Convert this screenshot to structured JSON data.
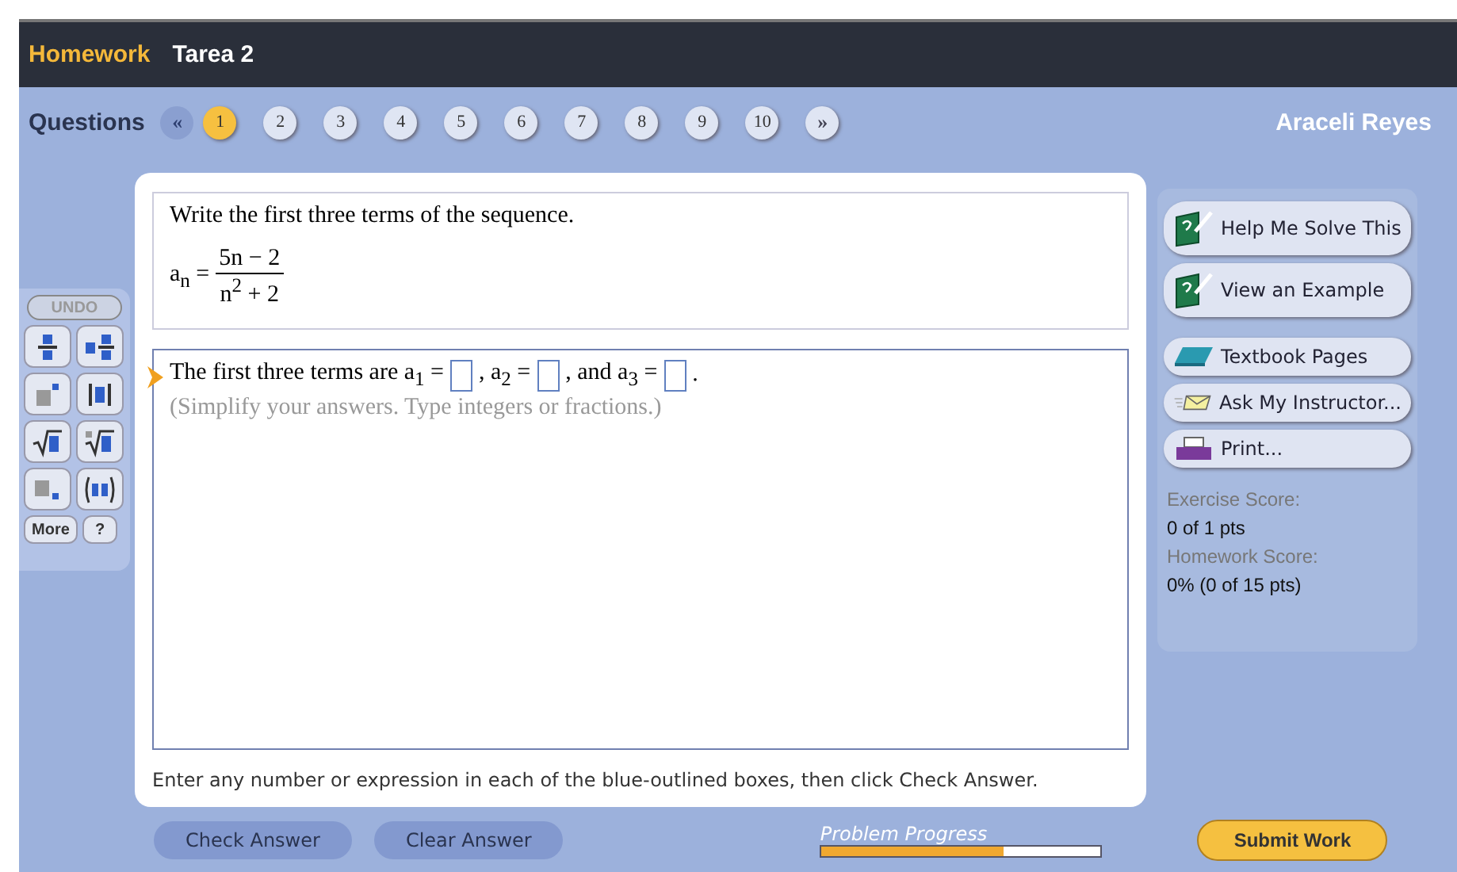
{
  "header": {
    "section": "Homework",
    "title": "Tarea 2"
  },
  "questions": {
    "label": "Questions",
    "prev": "«",
    "next": "»",
    "student": "Araceli Reyes",
    "items": [
      {
        "label": "1",
        "selected": true
      },
      {
        "label": "2",
        "selected": false
      },
      {
        "label": "3",
        "selected": false
      },
      {
        "label": "4",
        "selected": false
      },
      {
        "label": "5",
        "selected": false
      },
      {
        "label": "6",
        "selected": false
      },
      {
        "label": "7",
        "selected": false
      },
      {
        "label": "8",
        "selected": false
      },
      {
        "label": "9",
        "selected": false
      },
      {
        "label": "10",
        "selected": false
      }
    ]
  },
  "toolbar": {
    "undo": {
      "label": "UNDO",
      "disabled": true
    },
    "more": "More",
    "help": "?"
  },
  "question": {
    "prompt": "Write the first three terms of the sequence.",
    "lhs": "a$_{n}$ =",
    "numerator": "5n − 2",
    "denominator": "n$^{2}$ + 2"
  },
  "answer": {
    "parts": [
      {
        "kind": "text",
        "text": "The first three terms are a$_{1}$ ="
      },
      {
        "kind": "box"
      },
      {
        "kind": "text",
        "text": ", a$_{2}$ ="
      },
      {
        "kind": "box"
      },
      {
        "kind": "text",
        "text": ", and a$_{3}$ ="
      },
      {
        "kind": "box"
      },
      {
        "kind": "text",
        "text": "."
      }
    ],
    "hint": "(Simplify your answers. Type integers or fractions.)"
  },
  "instruction": "Enter any number or expression in each of the blue-outlined boxes, then click Check Answer.",
  "side_buttons": [
    {
      "kind": "help",
      "label": "Help Me Solve This"
    },
    {
      "kind": "example",
      "label": "View an Example"
    },
    {
      "kind": "textbook",
      "label": "Textbook Pages"
    },
    {
      "kind": "ask",
      "label": "Ask My Instructor..."
    },
    {
      "kind": "print",
      "label": "Print..."
    }
  ],
  "scores": [
    {
      "label": "Exercise Score:",
      "value": "0 of 1 pts"
    },
    {
      "label": "Homework Score:",
      "value": "0% (0 of 15 pts)"
    }
  ],
  "bottom": {
    "check": "Check Answer",
    "clear": "Clear Answer",
    "progress_label": "Problem Progress",
    "progress": {
      "level": 0.65
    },
    "submit": "Submit Work"
  }
}
